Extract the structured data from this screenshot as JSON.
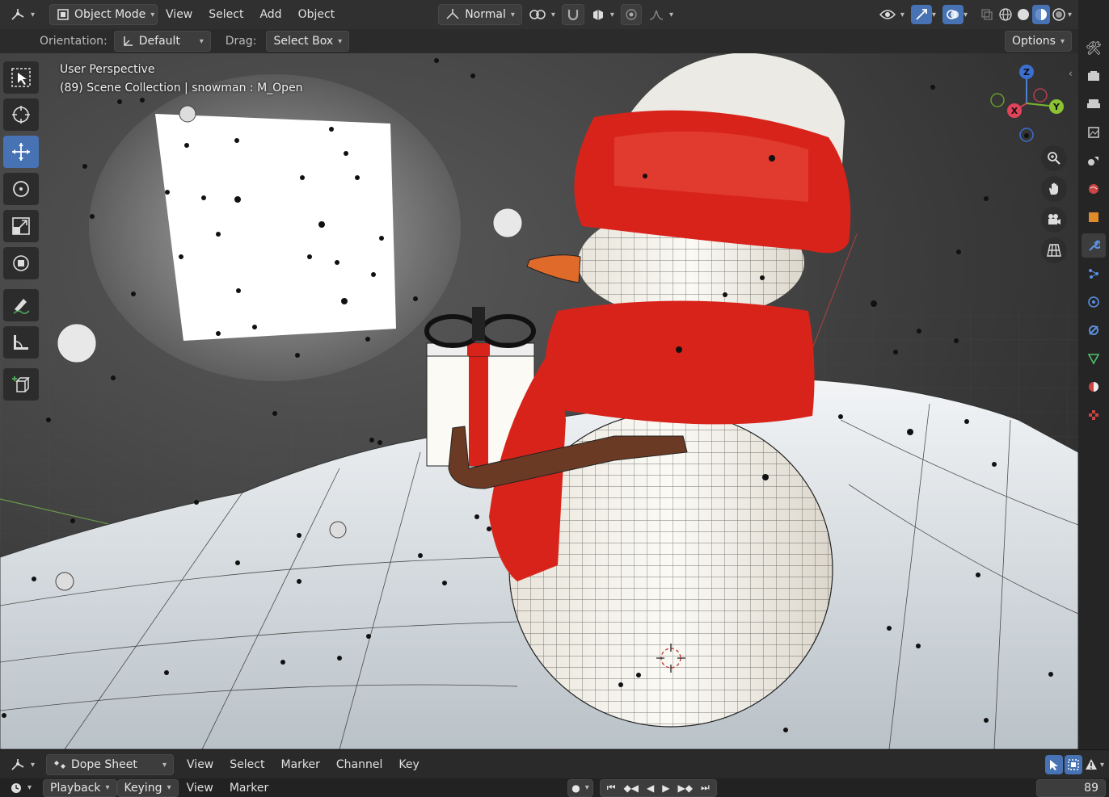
{
  "header": {
    "mode": "Object Mode",
    "menus": [
      "View",
      "Select",
      "Add",
      "Object"
    ],
    "transform_orientation": "Normal"
  },
  "tool_header": {
    "orientation_label": "Orientation:",
    "orientation_value": "Default",
    "drag_label": "Drag:",
    "drag_value": "Select Box",
    "options": "Options"
  },
  "viewport": {
    "perspective": "User Perspective",
    "collection_info": "(89) Scene Collection | snowman : M_Open",
    "gizmo_axes": [
      "Z",
      "X",
      "Y"
    ]
  },
  "dope_sheet": {
    "editor": "Dope Sheet",
    "menus": [
      "View",
      "Select",
      "Marker",
      "Channel",
      "Key"
    ]
  },
  "timeline": {
    "playback": "Playback",
    "keying": "Keying",
    "menus": [
      "View",
      "Marker"
    ],
    "current_frame": "89"
  },
  "colors": {
    "accent": "#4772b3",
    "scarf_red": "#d8231b",
    "snow": "#e8ecef"
  }
}
